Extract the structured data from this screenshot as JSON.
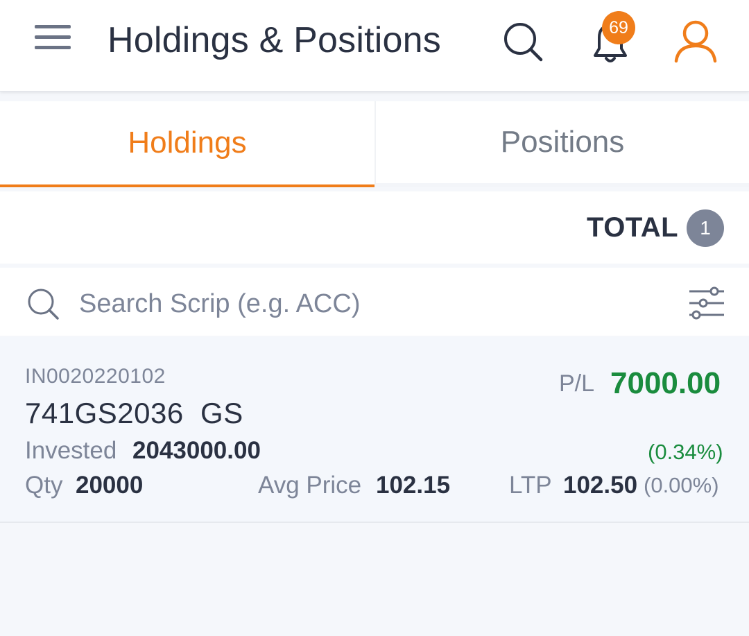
{
  "header": {
    "title": "Holdings & Positions",
    "notification_count": "69",
    "icons": {
      "menu": "hamburger-menu-icon",
      "search": "search-icon",
      "bell": "bell-icon",
      "user": "user-icon"
    },
    "accent_color": "#f07d1a"
  },
  "tabs": [
    {
      "label": "Holdings",
      "active": true
    },
    {
      "label": "Positions",
      "active": false
    }
  ],
  "summary": {
    "total_label": "TOTAL",
    "total_count": "1"
  },
  "search": {
    "placeholder": "Search Scrip (e.g. ACC)",
    "value": ""
  },
  "holdings": [
    {
      "isin": "IN0020220102",
      "name": "741GS2036  GS",
      "pl_label": "P/L",
      "pl_value": "7000.00",
      "pl_percent": "(0.34%)",
      "invested_label": "Invested",
      "invested_value": "2043000.00",
      "qty_label": "Qty",
      "qty_value": "20000",
      "avg_price_label": "Avg Price",
      "avg_price_value": "102.15",
      "ltp_label": "LTP",
      "ltp_value": "102.50",
      "ltp_change": "(0.00%)",
      "pl_color": "#1a8c3e"
    }
  ]
}
